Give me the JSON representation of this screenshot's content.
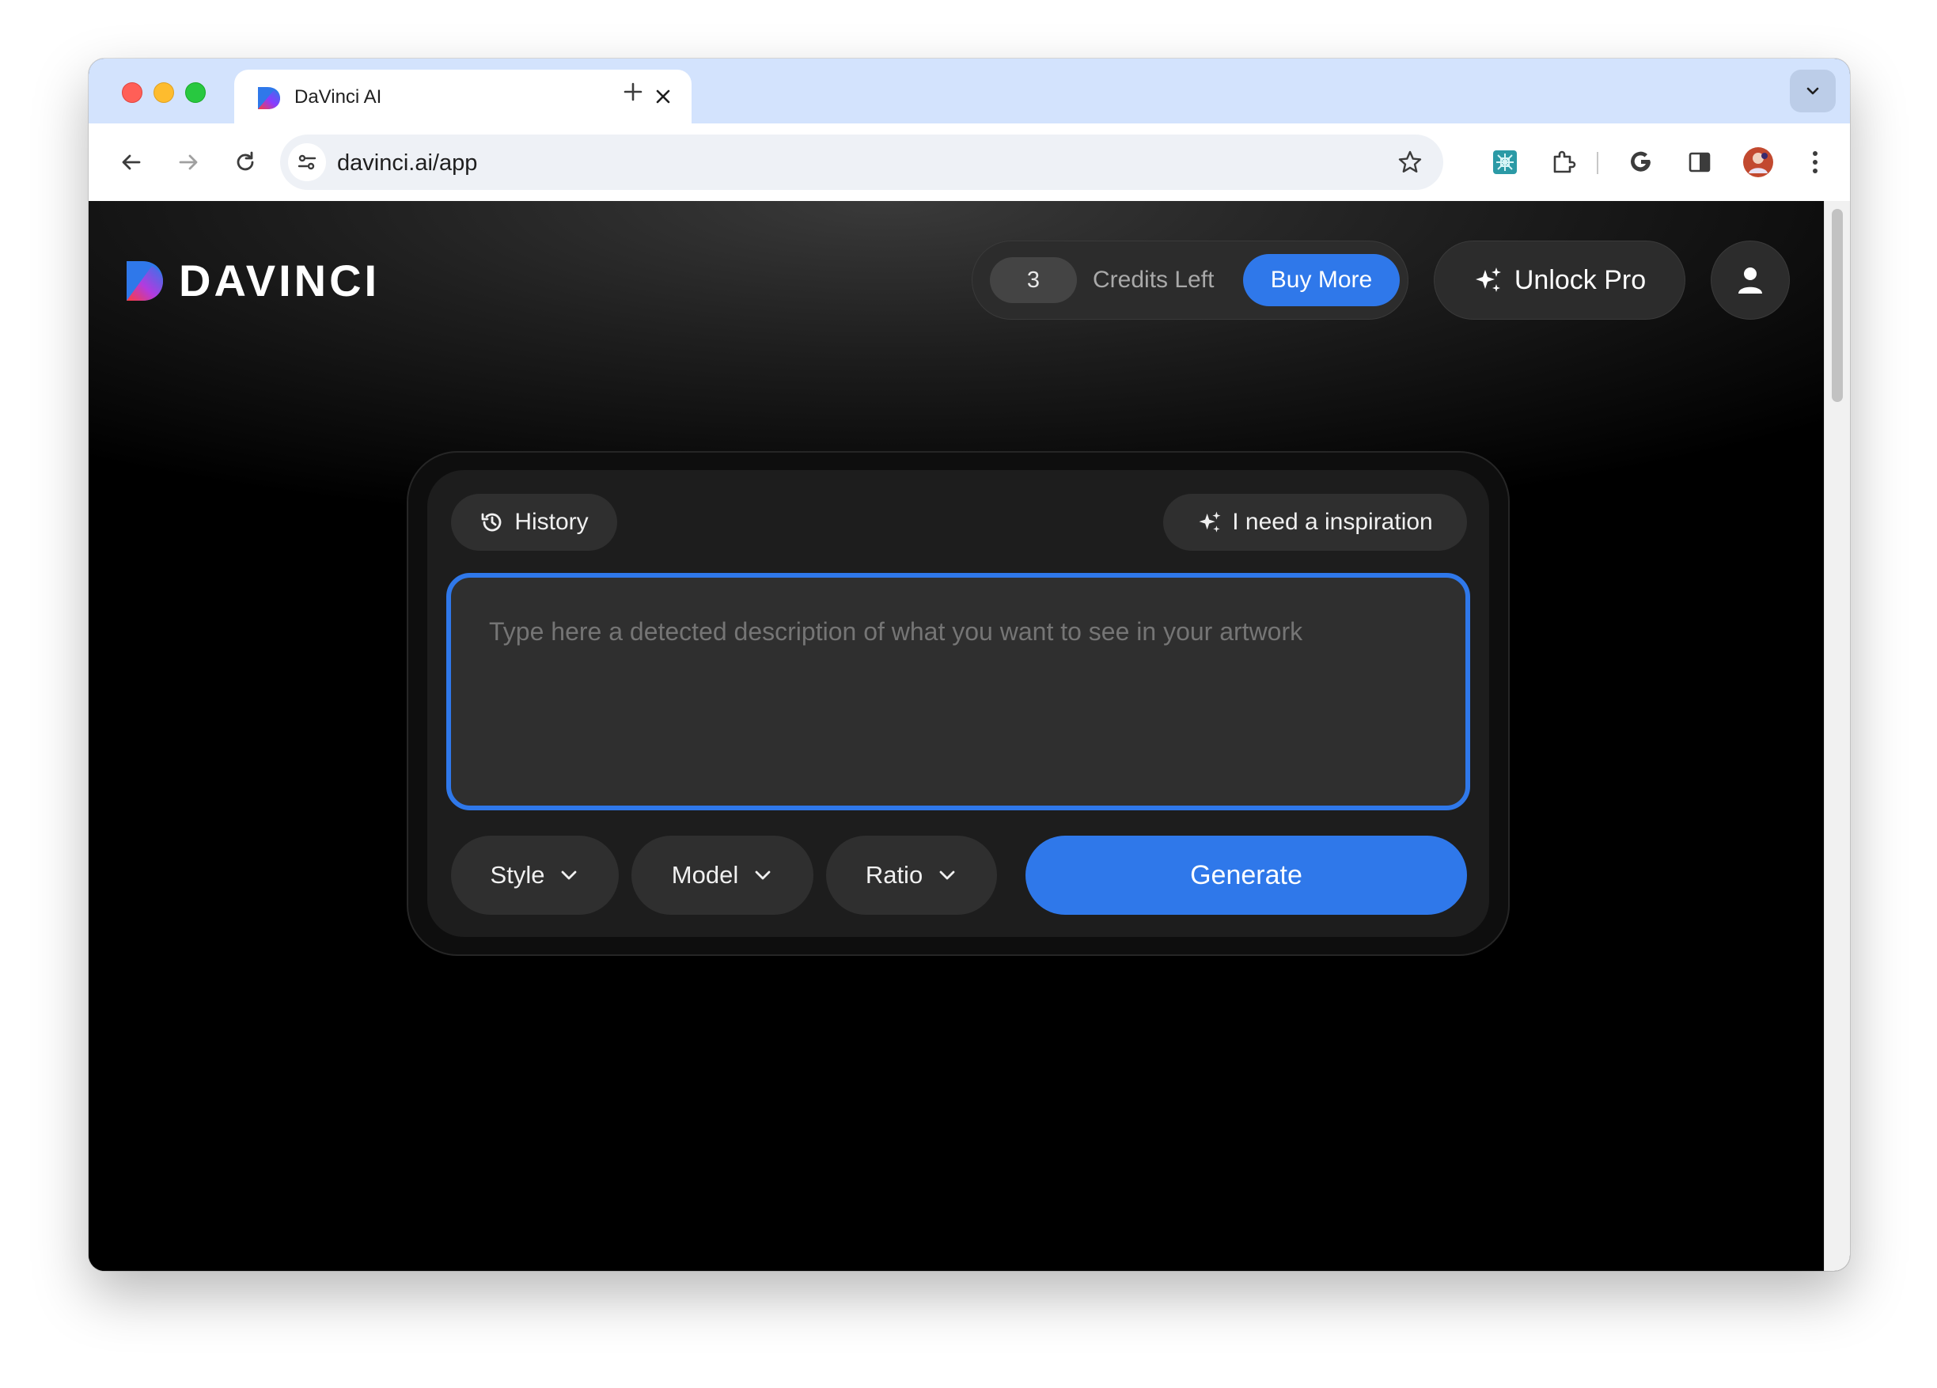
{
  "browser": {
    "tab_title": "DaVinci AI",
    "url": "davinci.ai/app"
  },
  "header": {
    "logo_text": "DAVINCI",
    "credits_count": "3",
    "credits_label": "Credits Left",
    "buy_more_label": "Buy More",
    "unlock_pro_label": "Unlock Pro"
  },
  "panel": {
    "history_label": "History",
    "inspiration_label": "I need a inspiration",
    "prompt_placeholder": "Type here a detected description of what you want to see in your artwork",
    "style_label": "Style",
    "model_label": "Model",
    "ratio_label": "Ratio",
    "generate_label": "Generate"
  },
  "colors": {
    "accent": "#2f78ea",
    "page_bg": "#000000",
    "panel_bg": "#1d1d1d",
    "pill_bg": "#2f2f2f",
    "chrome_tabstrip": "#d3e3fd"
  }
}
